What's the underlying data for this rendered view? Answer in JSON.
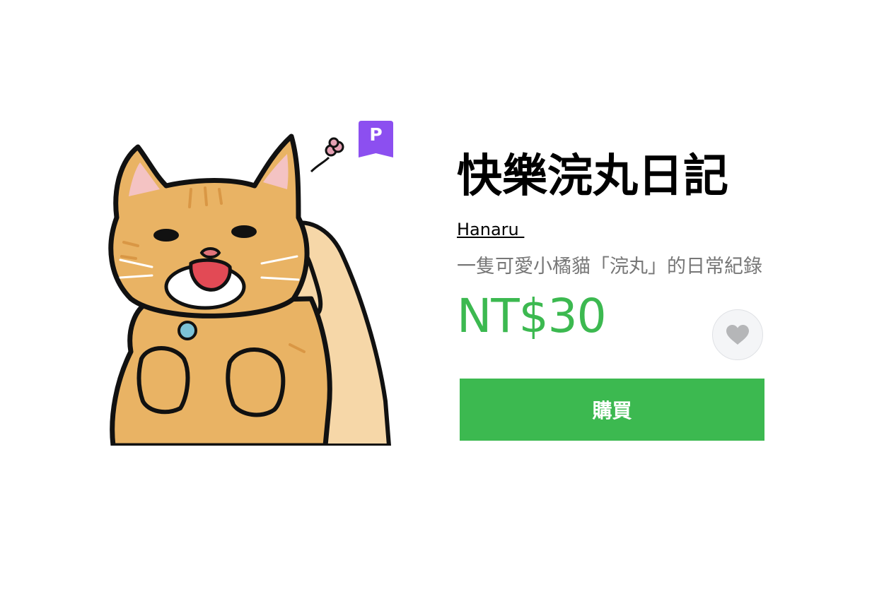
{
  "product": {
    "title": "快樂浣丸日記",
    "author": "Hanaru ",
    "description": "一隻可愛小橘貓「浣丸」的日常紀錄",
    "price": "NT$30",
    "premium_badge": "P",
    "buy_label": "購買"
  },
  "colors": {
    "price_green": "#3cb950",
    "buy_button_bg": "#3cb950",
    "premium_purple": "#8c4ff0",
    "favorite_icon": "#b5b6b8"
  },
  "icons": {
    "favorite": "heart-icon",
    "premium": "premium-badge-icon"
  }
}
